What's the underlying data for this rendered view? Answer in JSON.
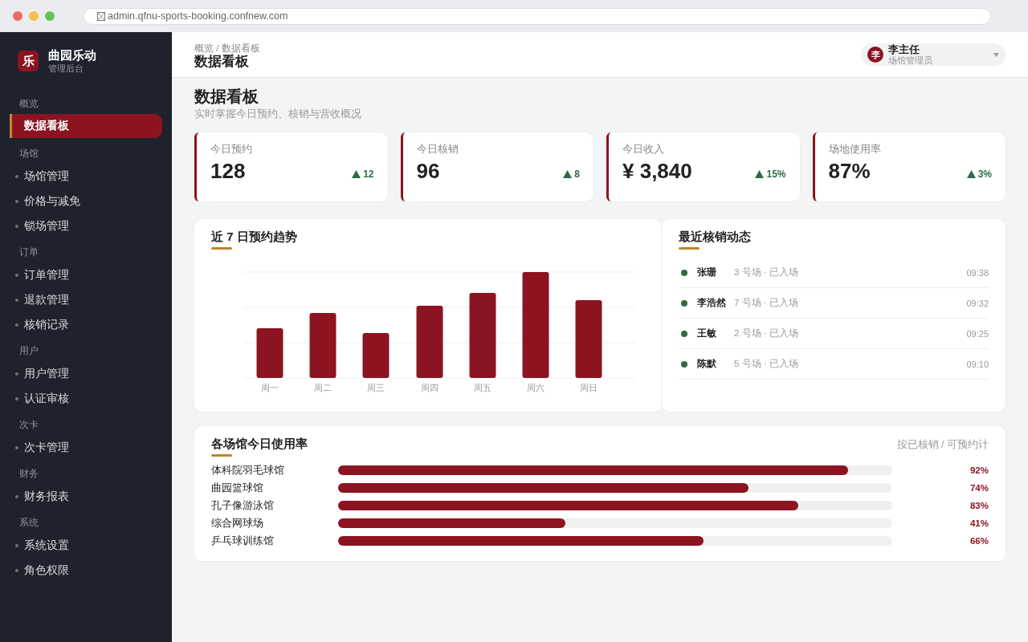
{
  "browser": {
    "url": "admin.qfnu-sports-booking.confnew.com"
  },
  "sidebar": {
    "logo": "乐",
    "title": "曲园乐动",
    "subtitle": "管理后台",
    "sections": [
      {
        "heading": "概览",
        "items": [
          {
            "label": "数据看板",
            "selected": true
          }
        ]
      },
      {
        "heading": "场馆",
        "items": [
          {
            "label": "场馆管理",
            "selected": false
          },
          {
            "label": "价格与减免",
            "selected": false
          },
          {
            "label": "锁场管理",
            "selected": false
          }
        ]
      },
      {
        "heading": "订单",
        "items": [
          {
            "label": "订单管理",
            "selected": false
          },
          {
            "label": "退款管理",
            "selected": false
          },
          {
            "label": "核销记录",
            "selected": false
          }
        ]
      },
      {
        "heading": "用户",
        "items": [
          {
            "label": "用户管理",
            "selected": false
          },
          {
            "label": "认证审核",
            "selected": false
          }
        ]
      },
      {
        "heading": "次卡",
        "items": [
          {
            "label": "次卡管理",
            "selected": false
          }
        ]
      },
      {
        "heading": "财务",
        "items": [
          {
            "label": "财务报表",
            "selected": false
          }
        ]
      },
      {
        "heading": "系统",
        "items": [
          {
            "label": "系统设置",
            "selected": false
          },
          {
            "label": "角色权限",
            "selected": false
          }
        ]
      }
    ]
  },
  "header": {
    "breadcrumb": "概览 / 数据看板",
    "title": "数据看板",
    "user": {
      "avatar": "李",
      "name": "李主任",
      "role": "场馆管理员"
    }
  },
  "page": {
    "title": "数据看板",
    "subtitle": "实时掌握今日预约、核销与营收概况"
  },
  "stats": [
    {
      "label": "今日预约",
      "value": "128",
      "change": "12"
    },
    {
      "label": "今日核销",
      "value": "96",
      "change": "8"
    },
    {
      "label": "今日收入",
      "value": "¥ 3,840",
      "change": "15%"
    },
    {
      "label": "场地使用率",
      "value": "87%",
      "change": "3%"
    }
  ],
  "trend": {
    "title": "近 7 日预约趋势",
    "days": [
      "周一",
      "周二",
      "周三",
      "周四",
      "周五",
      "周六",
      "周日"
    ]
  },
  "activity": {
    "title": "最近核销动态",
    "items": [
      {
        "name": "张珊",
        "detail": "3 号场 · 已入场",
        "time": "09:38"
      },
      {
        "name": "李浩然",
        "detail": "7 号场 · 已入场",
        "time": "09:32"
      },
      {
        "name": "王敏",
        "detail": "2 号场 · 已入场",
        "time": "09:25"
      },
      {
        "name": "陈默",
        "detail": "5 号场 · 已入场",
        "time": "09:10"
      }
    ]
  },
  "usage": {
    "title": "各场馆今日使用率",
    "note": "按已核销 / 可预约计",
    "rows": [
      {
        "name": "体科院羽毛球馆",
        "level": 0.92,
        "reading": "92%"
      },
      {
        "name": "曲园篮球馆",
        "level": 0.74,
        "reading": "74%"
      },
      {
        "name": "孔子像游泳馆",
        "level": 0.83,
        "reading": "83%"
      },
      {
        "name": "综合网球场",
        "level": 0.41,
        "reading": "41%"
      },
      {
        "name": "乒乓球训练馆",
        "level": 0.66,
        "reading": "66%"
      }
    ]
  }
}
